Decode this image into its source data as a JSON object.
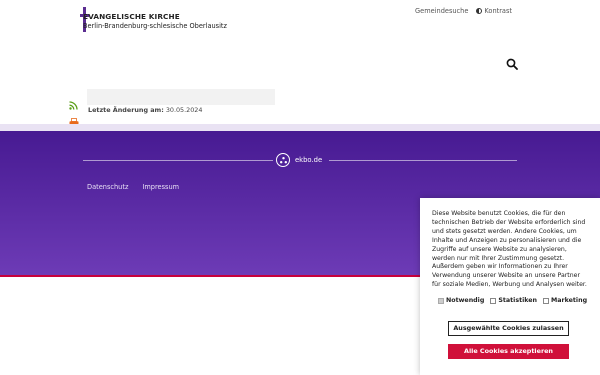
{
  "header": {
    "logo_line1": "EVANGELISCHE KIRCHE",
    "logo_line2": "Berlin-Brandenburg-schlesische Oberlausitz",
    "links": {
      "gemeindesuche": "Gemeindesuche",
      "kontrast": "Kontrast"
    },
    "search_icon": "search-icon"
  },
  "content": {
    "last_change_label": "Letzte Änderung am:",
    "last_change_date": "30.05.2024",
    "icons": [
      "rss-icon",
      "print-icon"
    ]
  },
  "footer": {
    "domain": "ekbo.de",
    "links": [
      "Datenschutz",
      "Impressum"
    ]
  },
  "cookie_banner": {
    "text": "Diese Website benutzt Cookies, die für den technischen Betrieb der Website erforderlich sind und stets gesetzt werden. Andere Cookies, um Inhalte und Anzeigen zu personalisieren und die Zugriffe auf unsere Website zu analysieren, werden nur mit Ihrer Zustimmung gesetzt. Außerdem geben wir Informationen zu Ihrer Verwendung unserer Website an unsere Partner für soziale Medien, Werbung und Analysen weiter.",
    "options": [
      {
        "label": "Notwendig",
        "checked": true
      },
      {
        "label": "Statistiken",
        "checked": false
      },
      {
        "label": "Marketing",
        "checked": false
      }
    ],
    "accept_selected": "Ausgewählte Cookies zulassen",
    "accept_all": "Alle Cookies akzeptieren"
  },
  "colors": {
    "brand_purple": "#5b2d91",
    "footer_top": "#471a92",
    "footer_bottom": "#6d3bb6",
    "accent_red": "#d0103a"
  }
}
